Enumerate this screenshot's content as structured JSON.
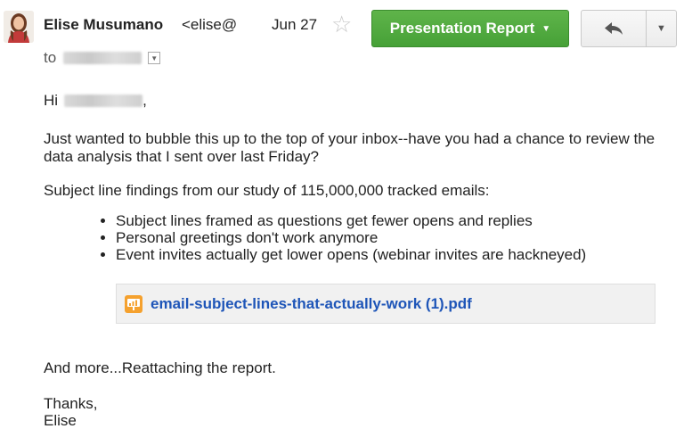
{
  "header": {
    "sender_name": "Elise Musumano",
    "sender_email": "<elise@",
    "date": "Jun 27",
    "star_icon": "star-outline-icon",
    "label_button": "Presentation Report",
    "reply_icon": "reply-arrow-icon",
    "more_icon": "chevron-down-icon",
    "to_label": "to",
    "label_color": "#4fa93f"
  },
  "body": {
    "greeting": "Hi",
    "greeting_suffix": ",",
    "paragraph1": "Just wanted to bubble this up to the top of your inbox--have you had a chance to review the data analysis that I sent over last Friday?",
    "paragraph2": "Subject line findings from our study of 115,000,000 tracked emails:",
    "findings": [
      "Subject lines framed as questions get fewer opens and replies",
      "Personal greetings don't work anymore",
      "Event invites actually get lower opens (webinar invites are hackneyed)"
    ],
    "attachment": {
      "name": "email-subject-lines-that-actually-work (1).pdf",
      "icon": "presentation-file-icon",
      "link_color": "#1e55b8"
    },
    "paragraph3": "And more...Reattaching the report.",
    "signoff_line1": "Thanks,",
    "signoff_line2": "Elise"
  }
}
